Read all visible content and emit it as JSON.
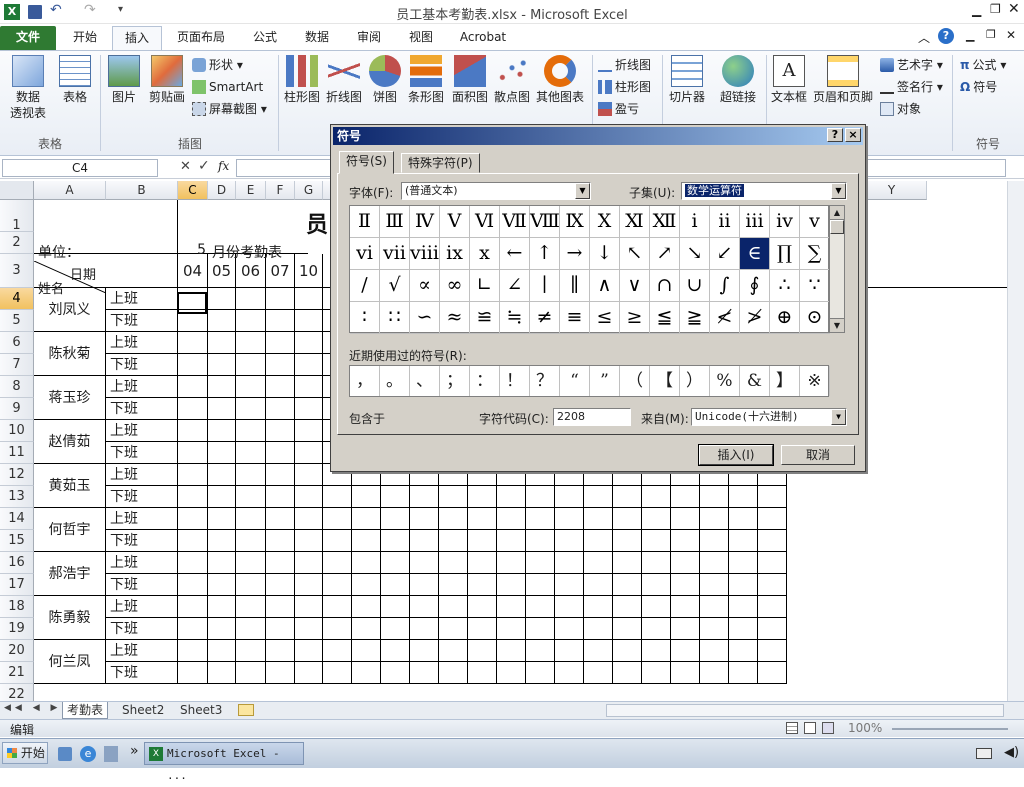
{
  "window": {
    "title": "员工基本考勤表.xlsx - Microsoft Excel"
  },
  "ribbon_tabs": [
    "文件",
    "开始",
    "插入",
    "页面布局",
    "公式",
    "数据",
    "审阅",
    "视图",
    "Acrobat"
  ],
  "ribbon": {
    "groups": {
      "tables": "表格",
      "illustrations": "插图",
      "symbols": "符号"
    },
    "buttons": {
      "pivot": "数据\n透视表",
      "table": "表格",
      "picture": "图片",
      "clipart": "剪贴画",
      "shapes": "形状",
      "smartart": "SmartArt",
      "screenshot": "屏幕截图",
      "bar": "柱形图",
      "line": "折线图",
      "pie": "饼图",
      "hbar": "条形图",
      "area": "面积图",
      "scatter": "散点图",
      "other": "其他图表",
      "spark_line": "折线图",
      "spark_col": "柱形图",
      "spark_wl": "盈亏",
      "slicer": "切片器",
      "hyperlink": "超链接",
      "textbox": "文本框",
      "headerfooter": "页眉和页脚",
      "wordart": "艺术字",
      "sigline": "签名行",
      "object": "对象",
      "equation": "公式",
      "symbol": "符号"
    }
  },
  "namebox": "C4",
  "fx": "fx",
  "columns": [
    "A",
    "B",
    "C",
    "D",
    "E",
    "F",
    "G",
    "H",
    "I",
    "J",
    "K",
    "L",
    "M",
    "N",
    "O",
    "P",
    "Q",
    "R",
    "S",
    "T",
    "U",
    "V",
    "W",
    "X",
    "Y"
  ],
  "rows": [
    "1",
    "2",
    "3",
    "4",
    "5",
    "6",
    "7",
    "8",
    "9",
    "10",
    "11",
    "12",
    "13",
    "14",
    "15",
    "16",
    "17",
    "18",
    "19",
    "20",
    "21",
    "22"
  ],
  "sheet": {
    "title_char": "员",
    "unit_label": "单位：",
    "month_num": "5",
    "month_label": "月份考勤表",
    "header_date": "日期",
    "header_name": "姓名",
    "dates": [
      "04",
      "05",
      "06",
      "07",
      "10"
    ],
    "shift_on": "上班",
    "shift_off": "下班",
    "employees": [
      "刘凤义",
      "陈秋菊",
      "蒋玉珍",
      "赵倩茹",
      "黄茹玉",
      "何哲宇",
      "郝浩宇",
      "陈勇毅",
      "何兰凤"
    ]
  },
  "sheet_tabs": [
    "考勤表",
    "Sheet2",
    "Sheet3"
  ],
  "status": {
    "mode": "编辑",
    "zoom": "100%"
  },
  "taskbar": {
    "start": "开始",
    "app": "Microsoft Excel - ..."
  },
  "dialog": {
    "title": "符号",
    "help": "?",
    "close": "×",
    "tab_symbols": "符号(S)",
    "tab_special": "特殊字符(P)",
    "font_label": "字体(F):",
    "font_value": "(普通文本)",
    "subset_label": "子集(U):",
    "subset_value": "数学运算符",
    "symbols": [
      "Ⅱ",
      "Ⅲ",
      "Ⅳ",
      "Ⅴ",
      "Ⅵ",
      "Ⅶ",
      "Ⅷ",
      "Ⅸ",
      "Ⅹ",
      "Ⅺ",
      "Ⅻ",
      "ⅰ",
      "ⅱ",
      "ⅲ",
      "ⅳ",
      "ⅴ",
      "ⅵ",
      "ⅶ",
      "ⅷ",
      "ⅸ",
      "ⅹ",
      "←",
      "↑",
      "→",
      "↓",
      "↖",
      "↗",
      "↘",
      "↙",
      "∈",
      "∏",
      "∑",
      "∕",
      "√",
      "∝",
      "∞",
      "∟",
      "∠",
      "∣",
      "∥",
      "∧",
      "∨",
      "∩",
      "∪",
      "∫",
      "∮",
      "∴",
      "∵",
      "∶",
      "∷",
      "∽",
      "≈",
      "≌",
      "≒",
      "≠",
      "≡",
      "≤",
      "≥",
      "≦",
      "≧",
      "≮",
      "≯",
      "⊕",
      "⊙"
    ],
    "selected_index": 29,
    "recent_label": "近期使用过的符号(R):",
    "recent": [
      "，",
      "。",
      "、",
      "；",
      "：",
      "！",
      "？",
      "“",
      "”",
      "（",
      "【",
      "）",
      "%",
      "&",
      "】",
      "※"
    ],
    "char_name": "包含于",
    "charcode_label": "字符代码(C):",
    "charcode_value": "2208",
    "from_label": "来自(M):",
    "from_value": "Unicode(十六进制)",
    "insert": "插入(I)",
    "cancel": "取消"
  }
}
